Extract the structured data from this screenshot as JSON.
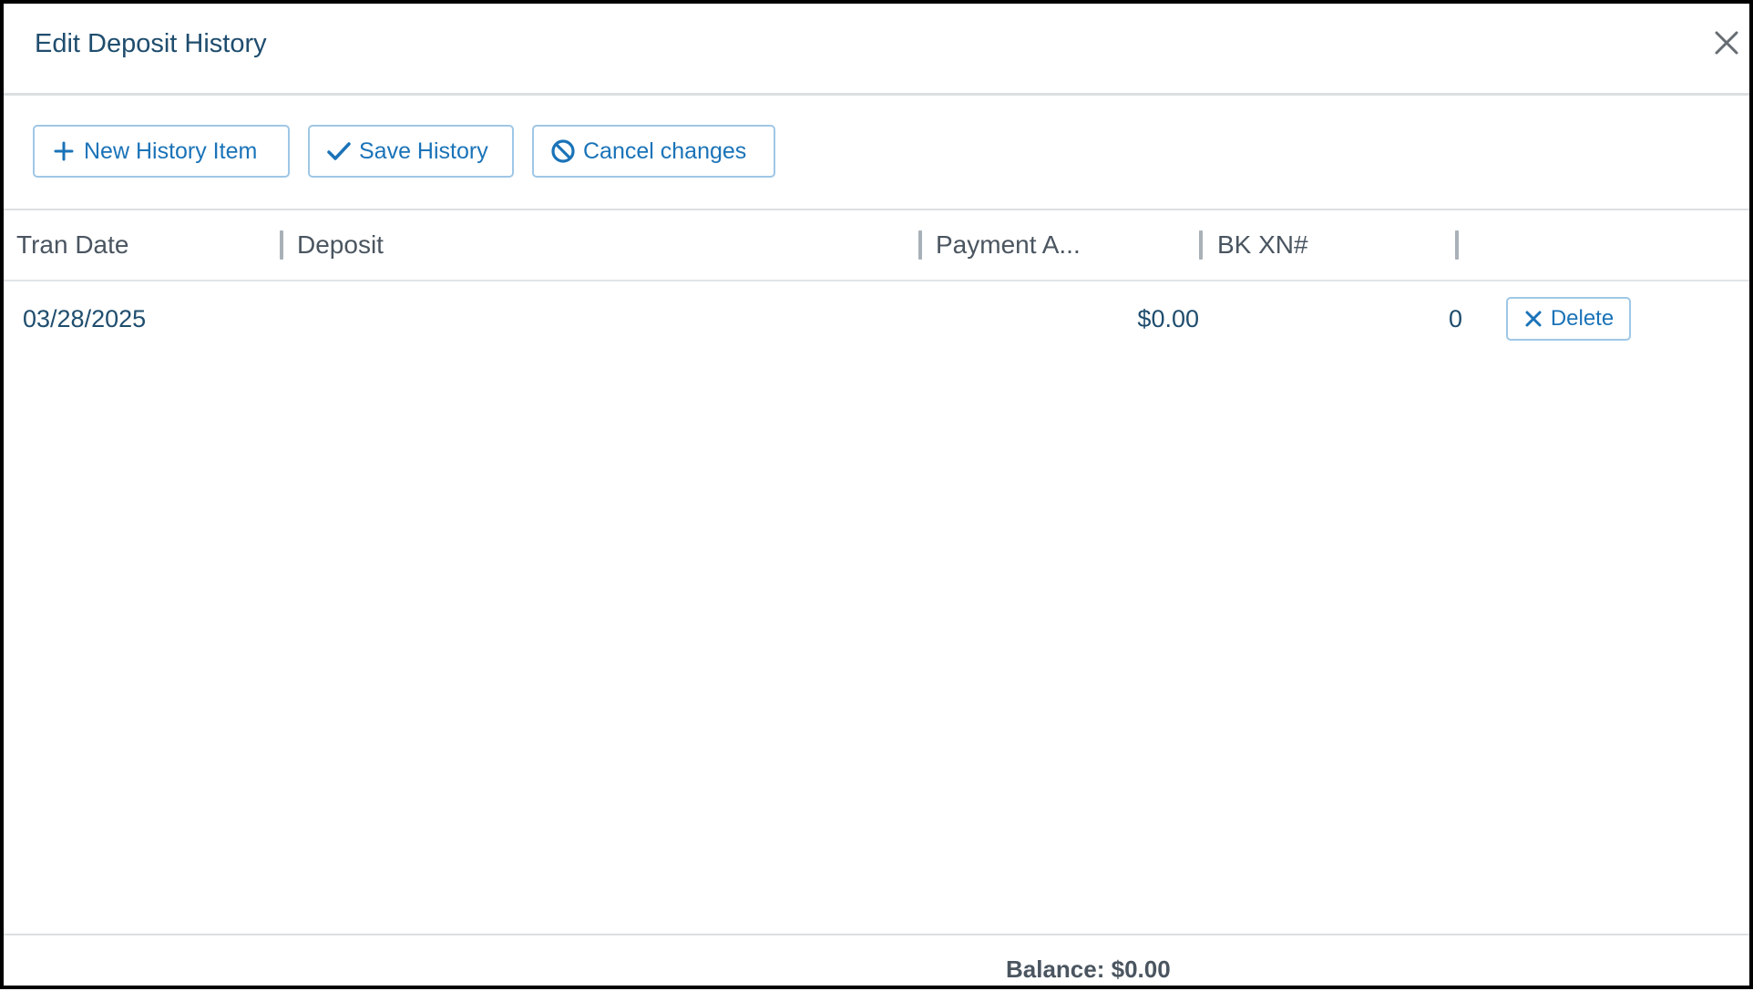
{
  "dialog": {
    "title": "Edit Deposit History"
  },
  "toolbar": {
    "new_label": "New History Item",
    "save_label": "Save History",
    "cancel_label": "Cancel changes"
  },
  "table": {
    "columns": [
      "Tran Date",
      "Deposit",
      "Payment A...",
      "BK XN#"
    ],
    "rows": [
      {
        "tran_date": "03/28/2025",
        "deposit": "",
        "payment_amount": "$0.00",
        "bk_xn": "0",
        "delete_label": "Delete"
      }
    ]
  },
  "footer": {
    "balance_text": "Balance: $0.00"
  },
  "colors": {
    "accent": "#1a73b8",
    "title": "#1f4d6e",
    "border": "#9fc7e6"
  },
  "icons": {
    "close": "close-icon",
    "new": "plus-icon",
    "save": "check-icon",
    "cancel": "ban-icon",
    "delete": "x-icon"
  }
}
